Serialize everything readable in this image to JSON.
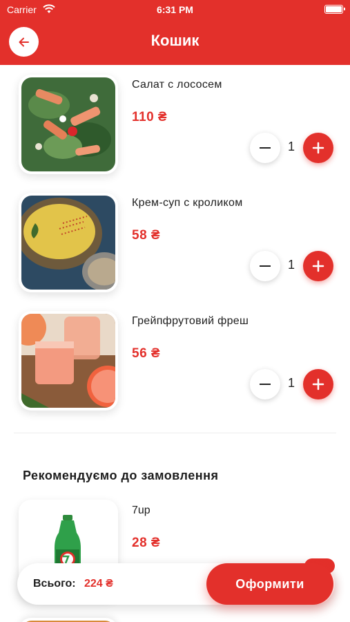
{
  "status_bar": {
    "carrier": "Carrier",
    "time": "6:31 PM"
  },
  "header": {
    "title": "Кошик",
    "back_icon": "arrow-left-icon"
  },
  "cart": {
    "items": [
      {
        "name": "Салат с лососем",
        "price": "110 ₴",
        "quantity": "1"
      },
      {
        "name": "Крем-суп с кроликом",
        "price": "58 ₴",
        "quantity": "1"
      },
      {
        "name": "Грейпфрутовий фреш",
        "price": "56 ₴",
        "quantity": "1"
      }
    ]
  },
  "recommendations": {
    "heading": "Рекомендуємо до замовлення",
    "items": [
      {
        "name": "7up",
        "price": "28 ₴"
      }
    ]
  },
  "footer": {
    "total_label": "Всього:",
    "total_amount": "224 ₴",
    "checkout_label": "Оформити"
  },
  "colors": {
    "accent": "#e3302b",
    "background": "#ffffff"
  }
}
